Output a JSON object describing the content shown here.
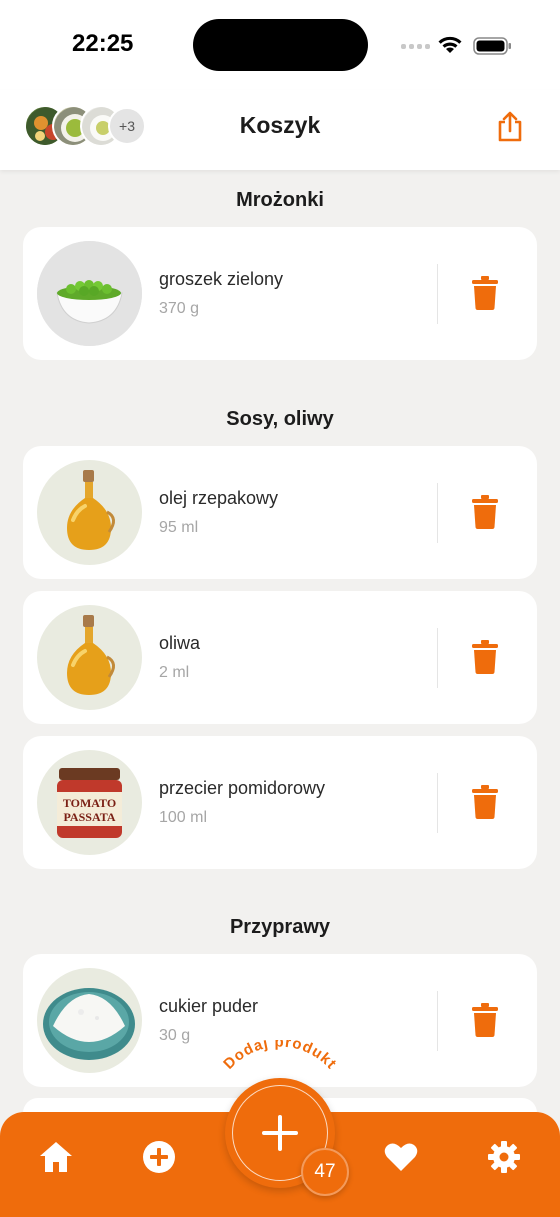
{
  "status_bar": {
    "time": "22:25"
  },
  "header": {
    "title": "Koszyk",
    "more_count": "+3"
  },
  "sections": [
    {
      "title": "Mrożonki",
      "items": [
        {
          "name": "groszek zielony",
          "qty": "370 g",
          "image": "peas-bowl"
        }
      ]
    },
    {
      "title": "Sosy, oliwy",
      "items": [
        {
          "name": "olej rzepakowy",
          "qty": "95 ml",
          "image": "oil-bottle"
        },
        {
          "name": "oliwa",
          "qty": "2 ml",
          "image": "oil-bottle"
        },
        {
          "name": "przecier pomidorowy",
          "qty": "100 ml",
          "image": "tomato-passata-jar",
          "label_line1": "TOMATO",
          "label_line2": "PASSATA"
        }
      ]
    },
    {
      "title": "Przyprawy",
      "items": [
        {
          "name": "cukier puder",
          "qty": "30 g",
          "image": "powdered-sugar-bowl"
        }
      ]
    }
  ],
  "fab": {
    "label": "Dodaj produkt",
    "badge": "47"
  },
  "nav": [
    "home-icon",
    "add-circle-icon",
    "heart-icon",
    "settings-icon"
  ],
  "colors": {
    "accent": "#ef6c0c",
    "background": "#f2f1ef",
    "card": "#ffffff"
  }
}
